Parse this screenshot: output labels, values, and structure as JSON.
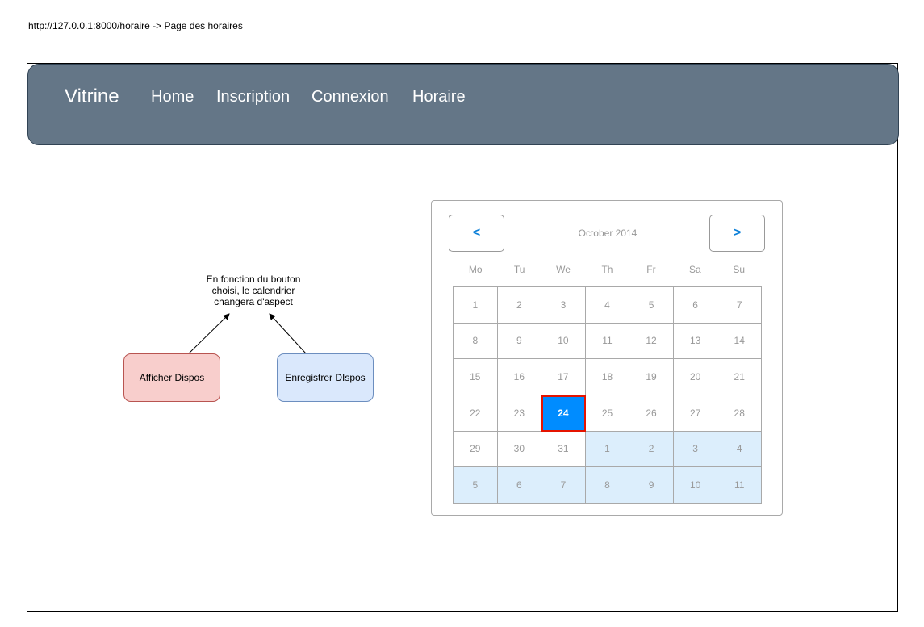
{
  "caption": "http://127.0.0.1:8000/horaire -> Page des horaires",
  "navbar": {
    "brand": "Vitrine",
    "links": [
      "Home",
      "Inscription",
      "Connexion",
      "Horaire"
    ],
    "bg_color": "#647687"
  },
  "note": {
    "lines": [
      "En fonction du bouton",
      "choisi, le calendrier",
      "changera d'aspect"
    ]
  },
  "buttons": {
    "afficher": "Afficher Dispos",
    "enregistrer": "Enregistrer DIspos"
  },
  "calendar": {
    "prev_label": "<",
    "next_label": ">",
    "month_title": "October 2014",
    "weekdays": [
      "Mo",
      "Tu",
      "We",
      "Th",
      "Fr",
      "Sa",
      "Su"
    ],
    "days": [
      {
        "label": "1",
        "state": "current"
      },
      {
        "label": "2",
        "state": "current"
      },
      {
        "label": "3",
        "state": "current"
      },
      {
        "label": "4",
        "state": "current"
      },
      {
        "label": "5",
        "state": "current"
      },
      {
        "label": "6",
        "state": "current"
      },
      {
        "label": "7",
        "state": "current"
      },
      {
        "label": "8",
        "state": "current"
      },
      {
        "label": "9",
        "state": "current"
      },
      {
        "label": "10",
        "state": "current"
      },
      {
        "label": "11",
        "state": "current"
      },
      {
        "label": "12",
        "state": "current"
      },
      {
        "label": "13",
        "state": "current"
      },
      {
        "label": "14",
        "state": "current"
      },
      {
        "label": "15",
        "state": "current"
      },
      {
        "label": "16",
        "state": "current"
      },
      {
        "label": "17",
        "state": "current"
      },
      {
        "label": "18",
        "state": "current"
      },
      {
        "label": "19",
        "state": "current"
      },
      {
        "label": "20",
        "state": "current"
      },
      {
        "label": "21",
        "state": "current"
      },
      {
        "label": "22",
        "state": "current"
      },
      {
        "label": "23",
        "state": "current"
      },
      {
        "label": "24",
        "state": "selected"
      },
      {
        "label": "25",
        "state": "current"
      },
      {
        "label": "26",
        "state": "current"
      },
      {
        "label": "27",
        "state": "current"
      },
      {
        "label": "28",
        "state": "current"
      },
      {
        "label": "29",
        "state": "current"
      },
      {
        "label": "30",
        "state": "current"
      },
      {
        "label": "31",
        "state": "current"
      },
      {
        "label": "1",
        "state": "other"
      },
      {
        "label": "2",
        "state": "other"
      },
      {
        "label": "3",
        "state": "other"
      },
      {
        "label": "4",
        "state": "other"
      },
      {
        "label": "5",
        "state": "other"
      },
      {
        "label": "6",
        "state": "other"
      },
      {
        "label": "7",
        "state": "other"
      },
      {
        "label": "8",
        "state": "other"
      },
      {
        "label": "9",
        "state": "other"
      },
      {
        "label": "10",
        "state": "other"
      },
      {
        "label": "11",
        "state": "other"
      }
    ],
    "selected_color": "#008cff",
    "other_month_color": "#dceefc"
  }
}
